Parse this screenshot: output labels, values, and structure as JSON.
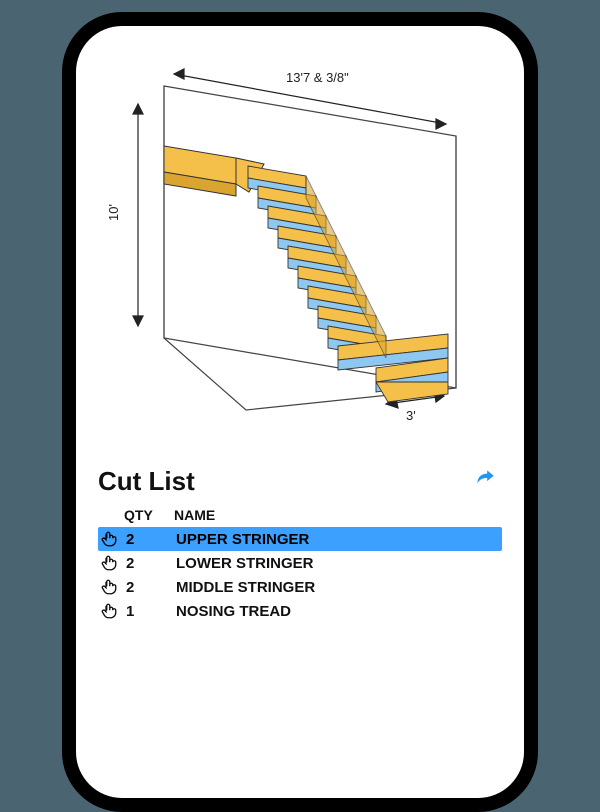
{
  "diagram": {
    "width_label": "13'7 & 3/8\"",
    "height_label": "10'",
    "depth_label": "3'"
  },
  "cut_list": {
    "title": "Cut List",
    "columns": {
      "qty": "QTY",
      "name": "NAME"
    },
    "rows": [
      {
        "qty": "2",
        "name": "UPPER STRINGER",
        "selected": true
      },
      {
        "qty": "2",
        "name": "LOWER STRINGER",
        "selected": false
      },
      {
        "qty": "2",
        "name": "MIDDLE STRINGER",
        "selected": false
      },
      {
        "qty": "1",
        "name": "NOSING TREAD",
        "selected": false
      }
    ]
  },
  "colors": {
    "accent": "#3ba0ff",
    "wood": "#f5c04a",
    "riser": "#8ec8f0"
  }
}
